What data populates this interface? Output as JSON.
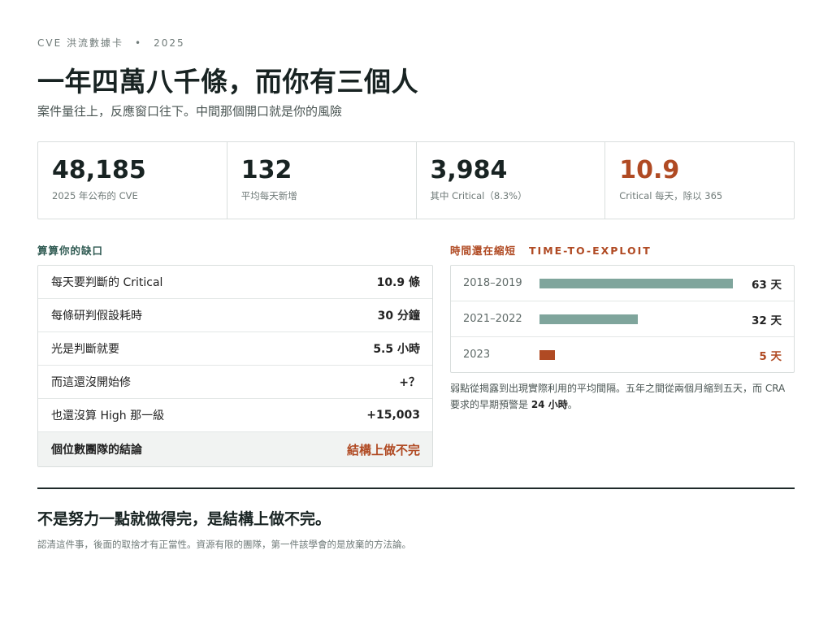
{
  "header": {
    "kicker_left": "CVE 洪流數據卡",
    "kicker_sep": "•",
    "kicker_right": "2025",
    "title": "一年四萬八千條，而你有三個人",
    "subtitle": "案件量往上，反應窗口往下。中間那個開口就是你的風險"
  },
  "stats": [
    {
      "value": "48,185",
      "label": "2025 年公布的 CVE"
    },
    {
      "value": "132",
      "label": "平均每天新增"
    },
    {
      "value": "3,984",
      "label": "其中 Critical（8.3%）"
    },
    {
      "value": "10.9",
      "label": "Critical 每天，除以 365"
    }
  ],
  "calc": {
    "heading": "算算你的缺口",
    "rows": [
      {
        "label": "每天要判斷的 Critical",
        "value": "10.9 條"
      },
      {
        "label": "每條研判假設耗時",
        "value": "30 分鐘"
      },
      {
        "label": "光是判斷就要",
        "value": "5.5 小時"
      },
      {
        "label": "而這還沒開始修",
        "value": "+？"
      },
      {
        "label": "也還沒算 High 那一級",
        "value": "+15,003"
      }
    ],
    "conclusion_label": "個位數團隊的結論",
    "conclusion_value": "結構上做不完"
  },
  "tte": {
    "heading": "時間還在縮短",
    "heading_en": "TIME-TO-EXPLOIT",
    "unit": "天",
    "rows": [
      {
        "period": "2018–2019",
        "days": 63,
        "days_label": "63 天"
      },
      {
        "period": "2021–2022",
        "days": 32,
        "days_label": "32 天"
      },
      {
        "period": "2023",
        "days": 5,
        "days_label": "5 天"
      }
    ],
    "note_pre": "弱點從揭露到出現實際利用的平均間隔。五年之間從兩個月縮到五天，而 CRA 要求的早期預警是 ",
    "note_bold": "24 小時",
    "note_post": "。"
  },
  "footer": {
    "title": "不是努力一點就做得完，是結構上做不完。",
    "subtitle": "認清這件事，後面的取捨才有正當性。資源有限的團隊，第一件該學會的是放棄的方法論。"
  },
  "colors": {
    "accent": "#b04a23",
    "bar": "#7fa59c",
    "heading_green": "#2f5a52"
  }
}
